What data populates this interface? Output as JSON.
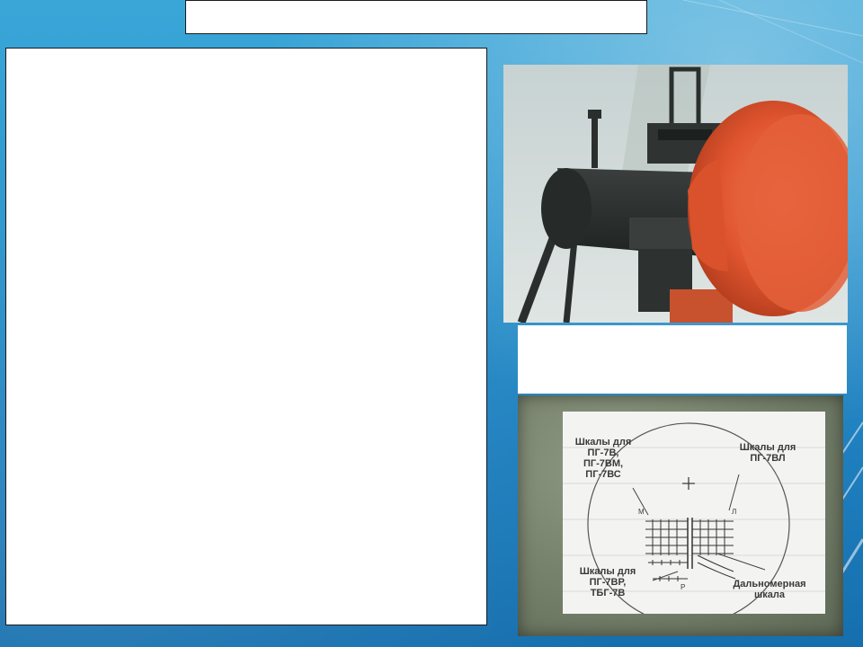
{
  "diagram": {
    "labels": {
      "top_left": [
        "Шкалы для",
        "ПГ-7В,",
        "ПГ-7ВМ,",
        "ПГ-7ВС"
      ],
      "top_right": [
        "Шкалы для",
        "ПГ-7ВЛ"
      ],
      "bottom_left": [
        "Шкалы для",
        "ПГ-7ВР,",
        "ТБГ-7В"
      ],
      "bottom_right": [
        "Дальномерная",
        "шкала"
      ]
    },
    "marks": {
      "left": "М",
      "right": "Л",
      "bottom": "Р"
    }
  }
}
